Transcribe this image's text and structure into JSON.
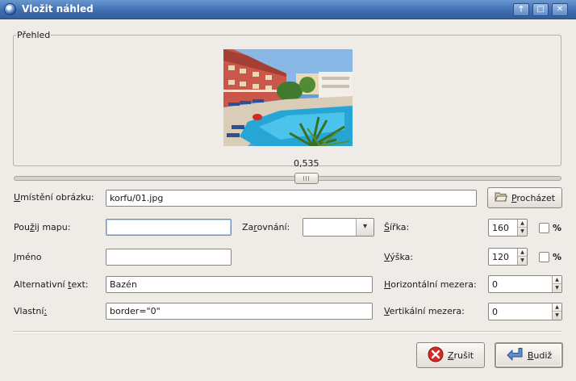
{
  "window": {
    "title": "Vložit náhled",
    "buttons": {
      "up": "🡑",
      "maximize": "□",
      "close": "✕"
    }
  },
  "preview": {
    "frame_label": "Přehled",
    "scale_value": "0,535",
    "scale_fraction": 0.535
  },
  "form": {
    "location": {
      "label_u": "U",
      "label_rest": "místění obrázku:",
      "value": "korfu/01.jpg"
    },
    "browse_button": {
      "label_u": "P",
      "label_rest": "rocházet",
      "icon": "folder-open-icon"
    },
    "use_map": {
      "label_pre": "Pou",
      "label_u": "ž",
      "label_rest": "ij mapu:",
      "value": ""
    },
    "align": {
      "label_pre": "Za",
      "label_u": "r",
      "label_rest": "ovnání:",
      "value": ""
    },
    "name": {
      "label_u": "J",
      "label_rest": "méno",
      "value": ""
    },
    "alt_text": {
      "label_pre": "Alternativní ",
      "label_u": "t",
      "label_rest": "ext:",
      "value": "Bazén"
    },
    "custom": {
      "label_pre": "Vlastní",
      "label_u": ":",
      "label_rest": "",
      "value": "border=\"0\""
    },
    "width": {
      "label_u": "Š",
      "label_pre": "",
      "label_rest": "ířka:",
      "value": "160",
      "percent_label": "%",
      "percent_checked": false
    },
    "height": {
      "label_u": "V",
      "label_rest": "ýška:",
      "value": "120",
      "percent_label": "%",
      "percent_checked": false
    },
    "hspace": {
      "label_u": "H",
      "label_rest": "orizontální mezera:",
      "value": "0"
    },
    "vspace": {
      "label_u": "V",
      "label_rest": "ertikální mezera:",
      "value": "0"
    }
  },
  "actions": {
    "cancel": {
      "label_u": "Z",
      "label_rest": "rušit",
      "icon": "cancel-icon"
    },
    "ok": {
      "label_u": "B",
      "label_rest": "udiž",
      "icon": "enter-arrow-icon"
    }
  },
  "colors": {
    "titlebar": "#3e6fb2",
    "cancel_icon": "#d42a25",
    "ok_icon": "#5b8fd2"
  }
}
